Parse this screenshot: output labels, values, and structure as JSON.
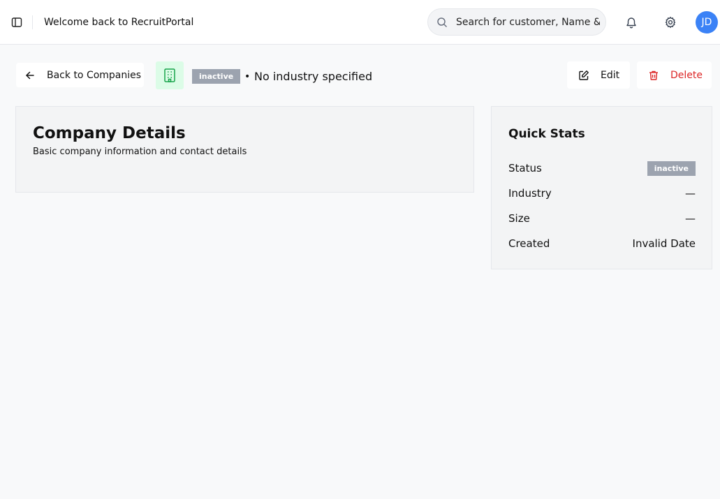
{
  "header": {
    "welcome": "Welcome back to RecruitPortal",
    "search_placeholder": "Search for customer, Name & ID",
    "avatar_initials": "JD"
  },
  "toolbar": {
    "back_label": "Back to Companies",
    "status_badge": "inactive",
    "separator": "•",
    "industry": "No industry specified",
    "edit_label": "Edit",
    "delete_label": "Delete"
  },
  "details": {
    "title": "Company Details",
    "subtitle": "Basic company information and contact details"
  },
  "stats": {
    "title": "Quick Stats",
    "rows": [
      {
        "label": "Status",
        "value": "inactive"
      },
      {
        "label": "Industry",
        "value": "—"
      },
      {
        "label": "Size",
        "value": "—"
      },
      {
        "label": "Created",
        "value": "Invalid Date"
      }
    ]
  },
  "colors": {
    "accent": "#3b82f6",
    "danger": "#dc2626",
    "badge": "#9ca3af",
    "company_icon_bg": "#dcfce7",
    "company_icon": "#16a34a"
  },
  "icons": {
    "sidebar_toggle": "sidebar-toggle-icon",
    "search": "search-icon",
    "bell": "bell-icon",
    "gear": "gear-icon",
    "back": "arrow-left-icon",
    "company": "building-icon",
    "edit": "edit-icon",
    "delete": "trash-icon"
  }
}
